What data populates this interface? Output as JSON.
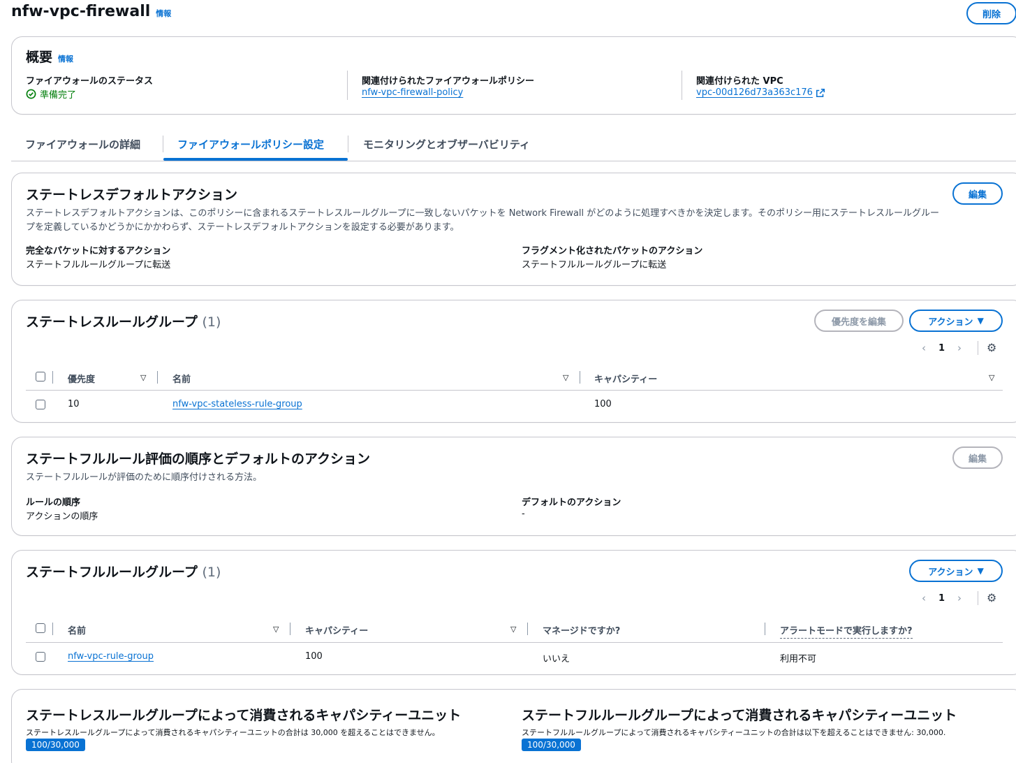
{
  "page": {
    "title": "nfw-vpc-firewall",
    "info_label": "情報",
    "delete_button": "削除"
  },
  "overview": {
    "title": "概要",
    "info_label": "情報",
    "status_label": "ファイアウォールのステータス",
    "status_value": "準備完了",
    "policy_label": "関連付けられたファイアウォールポリシー",
    "policy_value": "nfw-vpc-firewall-policy",
    "vpc_label": "関連付けられた VPC",
    "vpc_value": "vpc-00d126d73a363c176"
  },
  "tabs": [
    {
      "label": "ファイアウォールの詳細",
      "active": false
    },
    {
      "label": "ファイアウォールポリシー設定",
      "active": true
    },
    {
      "label": "モニタリングとオブザーバビリティ",
      "active": false
    }
  ],
  "stateless_default": {
    "title": "ステートレスデフォルトアクション",
    "edit_button": "編集",
    "description_line1": "ステートレスデフォルトアクションは、このポリシーに含まれるステートレスルールグループに一致しないパケットを Network Firewall がどのように処理すべきかを決定します。そのポリシー用にステートレスルールグルー",
    "description_line2": "プを定義しているかどうかにかかわらず、ステートレスデフォルトアクションを設定する必要があります。",
    "full_packet_label": "完全なパケットに対するアクション",
    "full_packet_value": "ステートフルルールグループに転送",
    "fragment_label": "フラグメント化されたパケットのアクション",
    "fragment_value": "ステートフルルールグループに転送"
  },
  "stateless_groups": {
    "title": "ステートレスルールグループ",
    "count": "(1)",
    "edit_priority_button": "優先度を編集",
    "actions_button": "アクション",
    "page_number": "1",
    "columns": [
      "優先度",
      "名前",
      "キャパシティー"
    ],
    "rows": [
      {
        "priority": "10",
        "name": "nfw-vpc-stateless-rule-group",
        "capacity": "100"
      }
    ]
  },
  "stateful_order": {
    "title": "ステートフルルール評価の順序とデフォルトのアクション",
    "edit_button": "編集",
    "description": "ステートフルルールが評価のために順序付けされる方法。",
    "rule_order_label": "ルールの順序",
    "rule_order_value": "アクションの順序",
    "default_action_label": "デフォルトのアクション",
    "default_action_value": "-"
  },
  "stateful_groups": {
    "title": "ステートフルルールグループ",
    "count": "(1)",
    "actions_button": "アクション",
    "page_number": "1",
    "columns": [
      "名前",
      "キャパシティー",
      "マネージドですか?",
      "アラートモードで実行しますか?"
    ],
    "rows": [
      {
        "name": "nfw-vpc-rule-group",
        "capacity": "100",
        "managed": "いいえ",
        "alert_mode": "利用不可"
      }
    ]
  },
  "capacity": {
    "stateless_title": "ステートレスルールグループによって消費されるキャパシティーユニット",
    "stateless_desc": "ステートレスルールグループによって消費されるキャパシティーユニットの合計は 30,000 を超えることはできません。",
    "stateless_badge": "100/30,000",
    "stateful_title": "ステートフルルールグループによって消費されるキャパシティーユニット",
    "stateful_desc": "ステートフルルールグループによって消費されるキャパシティーユニットの合計は以下を超えることはできません: 30,000.",
    "stateful_badge": "100/30,000"
  },
  "icons": {
    "status": "check-circle-icon",
    "external": "external-link-icon",
    "dropdown": "caret-down-icon",
    "sort": "sort-caret-icon",
    "settings": "gear-icon"
  },
  "colors": {
    "accent": "#0972d3",
    "success": "#037f0c",
    "border": "#c6c6cd"
  }
}
